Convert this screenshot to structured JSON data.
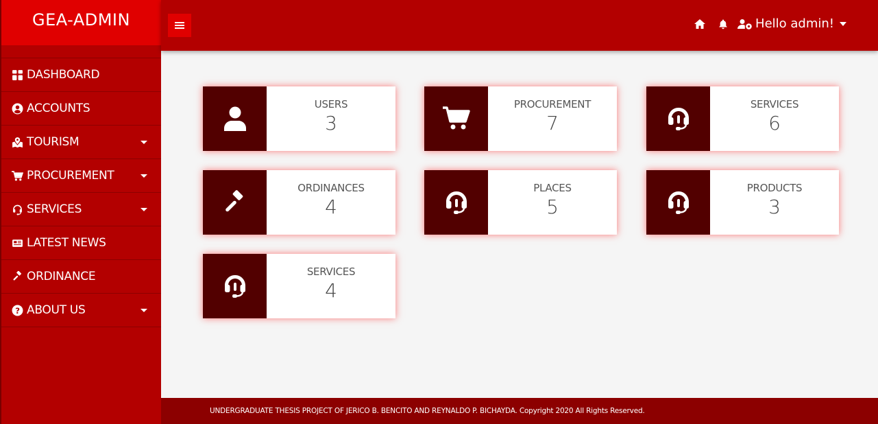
{
  "brand": "GEA-ADMIN",
  "sidebar": {
    "items": [
      {
        "label": "DASHBOARD",
        "icon": "dashboard-icon"
      },
      {
        "label": "ACCOUNTS",
        "icon": "user-circle-icon"
      },
      {
        "label": "TOURISM",
        "icon": "map-marked-icon",
        "has_submenu": true
      },
      {
        "label": "PROCUREMENT",
        "icon": "cart-icon",
        "has_submenu": true
      },
      {
        "label": "SERVICES",
        "icon": "headset-icon",
        "has_submenu": true
      },
      {
        "label": "LATEST NEWS",
        "icon": "newspaper-icon"
      },
      {
        "label": "ORDINANCE",
        "icon": "gavel-icon"
      },
      {
        "label": "ABOUT US",
        "icon": "question-circle-icon",
        "has_submenu": true
      }
    ]
  },
  "header": {
    "greeting": "Hello admin!",
    "icons": [
      "home-icon",
      "bell-icon",
      "user-cog-icon"
    ]
  },
  "cards": [
    {
      "title": "USERS",
      "value": "3",
      "icon": "user-icon"
    },
    {
      "title": "PROCUREMENT",
      "value": "7",
      "icon": "cart-icon"
    },
    {
      "title": "SERVICES",
      "value": "6",
      "icon": "headset-icon"
    },
    {
      "title": "ORDINANCES",
      "value": "4",
      "icon": "gavel-icon"
    },
    {
      "title": "PLACES",
      "value": "5",
      "icon": "headset-icon"
    },
    {
      "title": "PRODUCTS",
      "value": "3",
      "icon": "headset-icon"
    },
    {
      "title": "SERVICES",
      "value": "4",
      "icon": "headset-icon"
    }
  ],
  "footer": "UNDERGRADUATE THESIS PROJECT OF JERICO B. BENCITO AND REYNALDO P. BICHAYDA. Copyright 2020 All Rights Reserved.",
  "colors": {
    "sidebar_bg": "#b30000",
    "brand_bg": "#e00000",
    "card_icon_bg": "#520000",
    "footer_bg": "#8c0000",
    "content_bg": "#f5f5f5"
  }
}
